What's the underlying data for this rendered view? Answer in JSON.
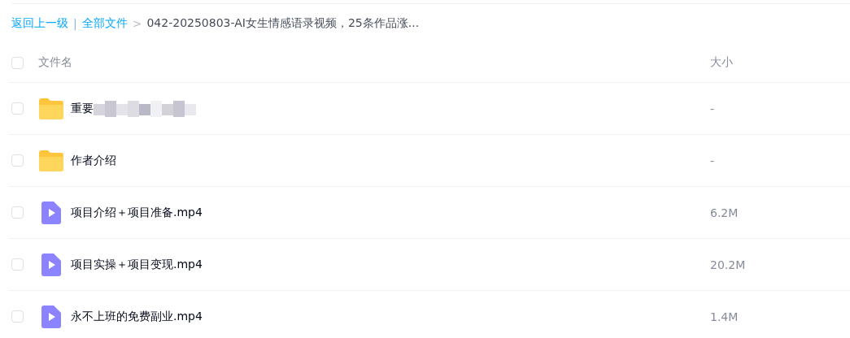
{
  "breadcrumb": {
    "back": "返回上一级",
    "separator": "|",
    "root": "全部文件",
    "arrow": ">",
    "current": "042-20250803-AI女生情感语录视频，25条作品涨..."
  },
  "table": {
    "columns": [
      "文件名",
      "大小"
    ],
    "all_checked": false,
    "rows": [
      {
        "kind": "folder",
        "name": "重要",
        "redacted": true,
        "size": "-",
        "checked": false
      },
      {
        "kind": "folder",
        "name": "作者介绍",
        "redacted": false,
        "size": "-",
        "checked": false
      },
      {
        "kind": "video",
        "name": "项目介绍＋项目准备.mp4",
        "redacted": false,
        "size": "6.2M",
        "checked": false
      },
      {
        "kind": "video",
        "name": "项目实操＋项目变现.mp4",
        "redacted": false,
        "size": "20.2M",
        "checked": false
      },
      {
        "kind": "video",
        "name": "永不上班的免费副业.mp4",
        "redacted": false,
        "size": "1.4M",
        "checked": false
      }
    ]
  }
}
